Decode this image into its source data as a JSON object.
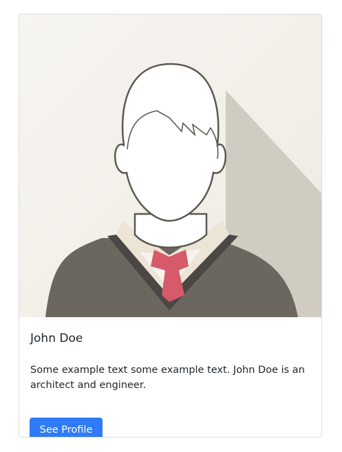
{
  "card": {
    "title": "John Doe",
    "text": "Some example text some example text. John Doe is an architect and engineer.",
    "button_label": "See Profile",
    "image_alt": "avatar-illustration"
  },
  "colors": {
    "button": "#2f7bf5",
    "background_light": "#f1ede6",
    "shadow": "#d1ccc2",
    "sweater": "#6b675e",
    "sweater_trim": "#4a4744",
    "collar": "#ece4d4",
    "tie": "#d65a6a",
    "outline": "#5b5851"
  }
}
